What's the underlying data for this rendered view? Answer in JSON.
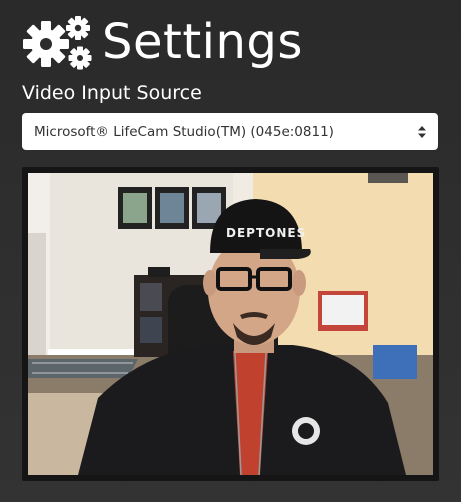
{
  "header": {
    "title": "Settings",
    "icon": "gears-icon"
  },
  "video_input": {
    "label": "Video Input Source",
    "selected": "Microsoft® LifeCam Studio(TM) (045e:0811)"
  },
  "video_preview": {
    "cap_text": "DEPTONES"
  },
  "colors": {
    "background": "#2d2d2d",
    "text": "#ffffff",
    "select_background": "#ffffff",
    "select_text": "#333333"
  }
}
